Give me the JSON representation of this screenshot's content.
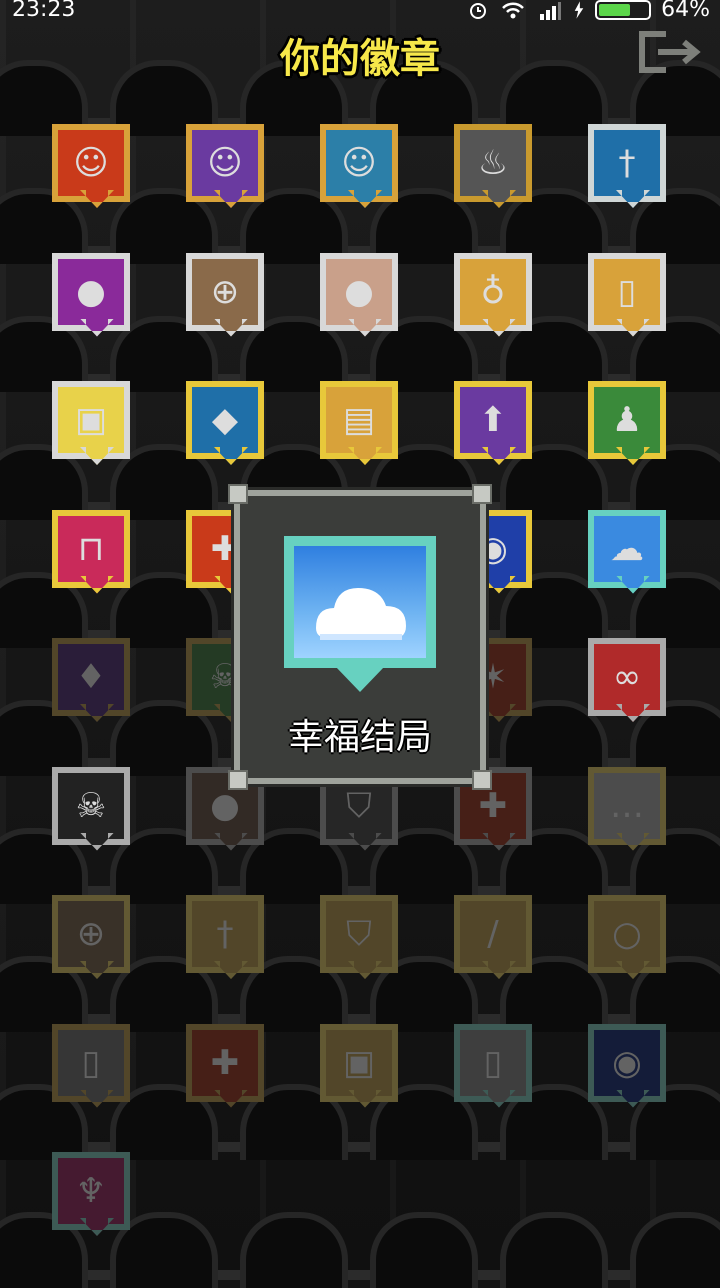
{
  "status_bar": {
    "time": "23:23",
    "battery": "64%",
    "battery_level": 0.64
  },
  "screen_title": "你的徽章",
  "popup": {
    "badge_name": "幸福结局",
    "badge_icon": "cloud-icon"
  },
  "badges": [
    {
      "icon": "white-haired-hero-icon",
      "colors": [
        "#c93a1a",
        "#d8a23a"
      ],
      "unlocked": true
    },
    {
      "icon": "mage-hero-icon",
      "colors": [
        "#6a3aa0",
        "#d8a23a"
      ],
      "unlocked": true
    },
    {
      "icon": "huntress-hero-icon",
      "colors": [
        "#2c7fa8",
        "#d8a23a"
      ],
      "unlocked": true
    },
    {
      "icon": "fire-icon",
      "colors": [
        "#555555",
        "#c99a2e"
      ],
      "unlocked": true
    },
    {
      "icon": "sword-icon",
      "colors": [
        "#1f6fa8",
        "#cfd6d6"
      ],
      "unlocked": true
    },
    {
      "icon": "gold-coin-icon",
      "colors": [
        "#8a2a9a",
        "#d8d8d8"
      ],
      "unlocked": true
    },
    {
      "icon": "seed-icon",
      "colors": [
        "#8a6a4a",
        "#d8d8d8"
      ],
      "unlocked": true
    },
    {
      "icon": "pot-icon",
      "colors": [
        "#c9a08a",
        "#d8d8d8"
      ],
      "unlocked": true
    },
    {
      "icon": "potion-flask-icon",
      "colors": [
        "#d8a23a",
        "#d8d8d8"
      ],
      "unlocked": true
    },
    {
      "icon": "scroll-icon",
      "colors": [
        "#d8a23a",
        "#d8d8d8"
      ],
      "unlocked": true
    },
    {
      "icon": "chest-icon",
      "colors": [
        "#e8d24a",
        "#d8d8d8"
      ],
      "unlocked": true
    },
    {
      "icon": "fish-icon",
      "colors": [
        "#1f6fa8",
        "#e8c83a"
      ],
      "unlocked": true
    },
    {
      "icon": "bag-icon",
      "colors": [
        "#d8a23a",
        "#e8c83a"
      ],
      "unlocked": true
    },
    {
      "icon": "level-up-arrow-icon",
      "colors": [
        "#6a3aa0",
        "#e8c83a"
      ],
      "unlocked": true
    },
    {
      "icon": "pawn-icon",
      "colors": [
        "#3a8a3a",
        "#e8c83a"
      ],
      "unlocked": true
    },
    {
      "icon": "lock-icon",
      "colors": [
        "#c92a5a",
        "#e8c83a"
      ],
      "unlocked": true
    },
    {
      "icon": "health-cross-icon",
      "colors": [
        "#c93a1a",
        "#e8c83a"
      ],
      "unlocked": true
    },
    {
      "icon": "hidden-icon",
      "colors": [
        "#444444",
        "#888888"
      ],
      "unlocked": true
    },
    {
      "icon": "orb-icon",
      "colors": [
        "#1f3fa8",
        "#e8c83a"
      ],
      "unlocked": true
    },
    {
      "icon": "cloud-icon",
      "colors": [
        "#3a8ae0",
        "#67d1c0"
      ],
      "unlocked": true
    },
    {
      "icon": "potion-icon",
      "colors": [
        "#6a3aa0",
        "#c99a2e"
      ],
      "unlocked": false
    },
    {
      "icon": "skull-icon",
      "colors": [
        "#3a8a3a",
        "#c99a2e"
      ],
      "unlocked": false
    },
    {
      "icon": "hidden-icon",
      "colors": [
        "#444444",
        "#888888"
      ],
      "unlocked": false
    },
    {
      "icon": "star-icon",
      "colors": [
        "#c93a1a",
        "#c99a2e"
      ],
      "unlocked": false
    },
    {
      "icon": "sunglasses-icon",
      "colors": [
        "#b02a2a",
        "#aaaaaa"
      ],
      "unlocked": true
    },
    {
      "icon": "skull-white-icon",
      "colors": [
        "#222222",
        "#aaaaaa"
      ],
      "unlocked": true
    },
    {
      "icon": "pot-icon",
      "colors": [
        "#7a5a4a",
        "#aaaaaa"
      ],
      "unlocked": false
    },
    {
      "icon": "armor-icon",
      "colors": [
        "#555555",
        "#aaaaaa"
      ],
      "unlocked": false
    },
    {
      "icon": "health-cross-icon",
      "colors": [
        "#c93a1a",
        "#aaaaaa"
      ],
      "unlocked": false
    },
    {
      "icon": "dots-icon",
      "colors": [
        "#aaaaaa",
        "#e8c83a"
      ],
      "unlocked": false
    },
    {
      "icon": "seed-icon",
      "colors": [
        "#8a6a4a",
        "#e8c83a"
      ],
      "unlocked": false
    },
    {
      "icon": "sword-icon",
      "colors": [
        "#c99a2e",
        "#e8c83a"
      ],
      "unlocked": false
    },
    {
      "icon": "armor-icon",
      "colors": [
        "#c99a2e",
        "#e8c83a"
      ],
      "unlocked": false
    },
    {
      "icon": "wand-icon",
      "colors": [
        "#c99a2e",
        "#e8c83a"
      ],
      "unlocked": false
    },
    {
      "icon": "ring-icon",
      "colors": [
        "#c99a2e",
        "#e8c83a"
      ],
      "unlocked": false
    },
    {
      "icon": "scroll-icon",
      "colors": [
        "#777777",
        "#c99a2e"
      ],
      "unlocked": false
    },
    {
      "icon": "health-cross-icon",
      "colors": [
        "#c93a1a",
        "#c99a2e"
      ],
      "unlocked": false
    },
    {
      "icon": "chest-icon",
      "colors": [
        "#c99a2e",
        "#e8c83a"
      ],
      "unlocked": false
    },
    {
      "icon": "tablet-icon",
      "colors": [
        "#8a8a8a",
        "#67d1c0"
      ],
      "unlocked": false
    },
    {
      "icon": "orb-icon",
      "colors": [
        "#1f3fa8",
        "#67d1c0"
      ],
      "unlocked": false
    },
    {
      "icon": "trophy-icon",
      "colors": [
        "#c92a7a",
        "#67d1c0"
      ],
      "unlocked": false
    }
  ]
}
